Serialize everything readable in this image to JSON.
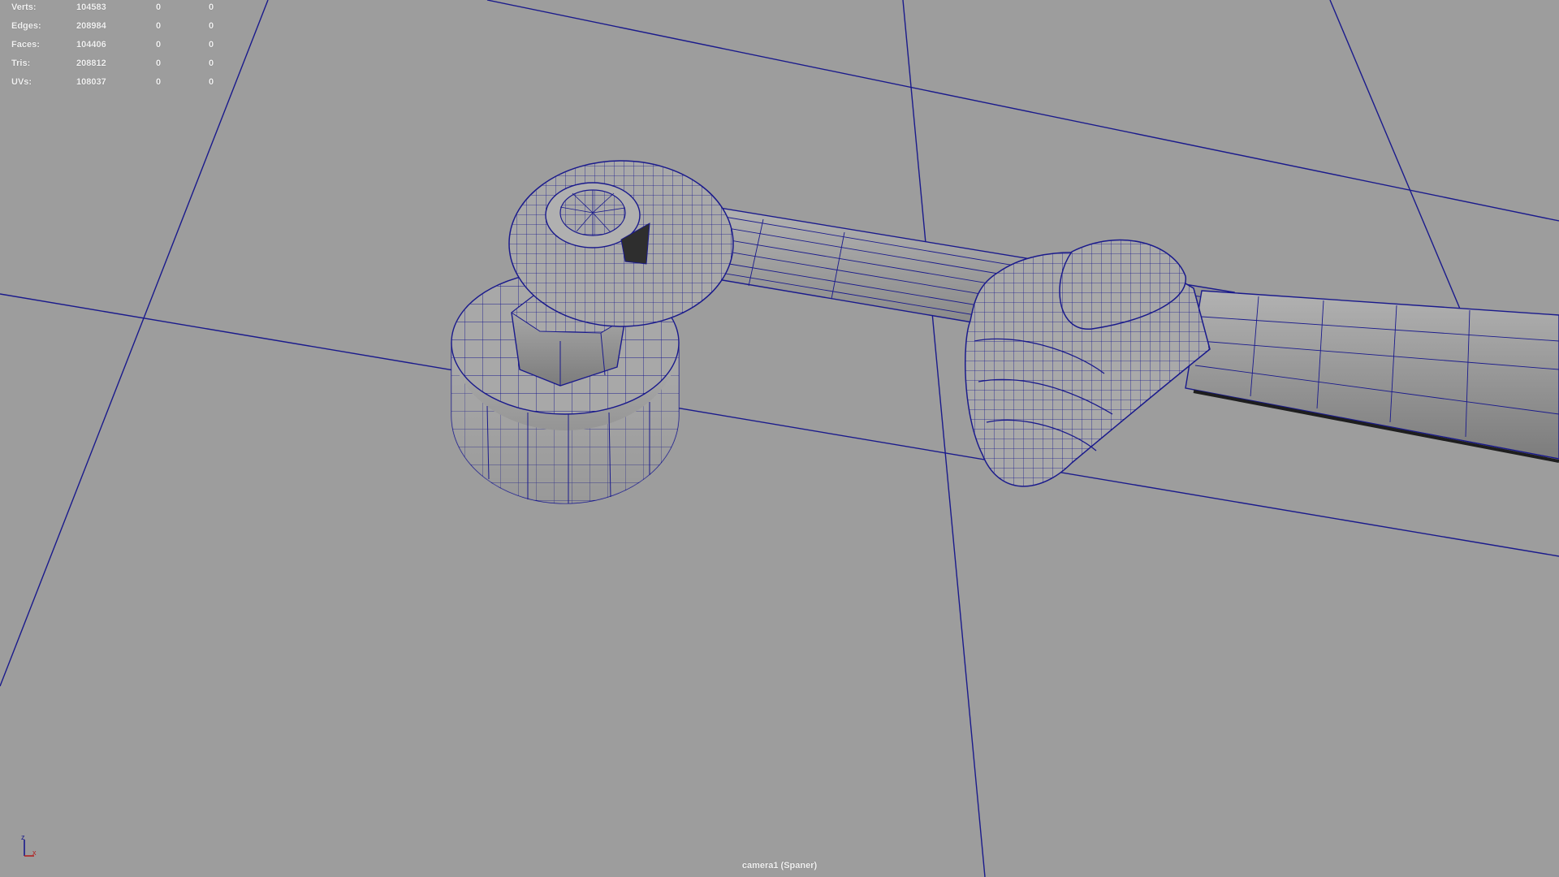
{
  "hud": {
    "rows": [
      {
        "label": "Verts:",
        "v1": "104583",
        "v2": "0",
        "v3": "0"
      },
      {
        "label": "Edges:",
        "v1": "208984",
        "v2": "0",
        "v3": "0"
      },
      {
        "label": "Faces:",
        "v1": "104406",
        "v2": "0",
        "v3": "0"
      },
      {
        "label": "Tris:",
        "v1": "208812",
        "v2": "0",
        "v3": "0"
      },
      {
        "label": "UVs:",
        "v1": "108037",
        "v2": "0",
        "v3": "0"
      }
    ]
  },
  "camera": {
    "label": "camera1 (Spaner)"
  },
  "axis": {
    "z_label": "z",
    "x_label": "x"
  },
  "colors": {
    "background": "#9d9d9d",
    "wire": "#1a1a8c",
    "mesh_fill": "#a6a6a6",
    "mesh_dark": "#6e6e6e",
    "hud_text": "#f2f2f2"
  }
}
